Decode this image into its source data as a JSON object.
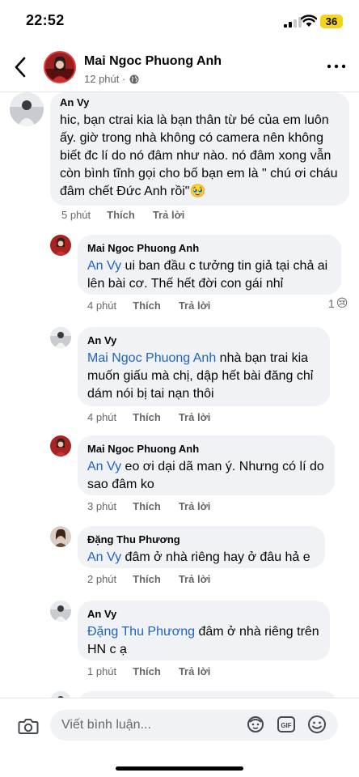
{
  "status_bar": {
    "time": "22:52",
    "battery": "36"
  },
  "header": {
    "name": "Mai Ngoc Phuong Anh",
    "subtitle": "12 phút ·"
  },
  "comments": [
    {
      "author": "An Vy",
      "mention": "",
      "text": "hic, bạn ctrai kia là bạn thân từ bé của em luôn ấy. giờ trong nhà không có camera nên không biết đc lí do nó đâm như nào. nó đâm xong vẫn còn bình tĩnh gọi cho bố bạn em là \" chú ơi cháu đâm chết Đức Anh rồi\"🥹",
      "time": "5 phút",
      "like": "Thích",
      "reply": "Trả lời"
    },
    {
      "author": "Mai Ngoc Phuong Anh",
      "mention": "An Vy",
      "text": " ui ban đầu c tưởng tin giả tại chả ai lên bài cơ. Thế hết đời con gái nhỉ",
      "time": "4 phút",
      "like": "Thích",
      "reply": "Trả lời",
      "reaction_count": "1",
      "reaction_emoji": "😢"
    },
    {
      "author": "An Vy",
      "mention": "Mai Ngoc Phuong Anh",
      "text": " nhà bạn trai kia muốn giấu mà chị, dập hết bài đăng chỉ dám nói bị tai nạn thôi",
      "time": "4 phút",
      "like": "Thích",
      "reply": "Trả lời"
    },
    {
      "author": "Mai Ngoc Phuong Anh",
      "mention": "An Vy",
      "text": " eo ơi dại dã man ý. Nhưng có lí do sao đâm ko",
      "time": "3 phút",
      "like": "Thích",
      "reply": "Trả lời"
    },
    {
      "author": "Đặng Thu Phương",
      "mention": "An Vy",
      "text": " đâm ở nhà riêng hay ở  đâu hả e",
      "time": "2 phút",
      "like": "Thích",
      "reply": "Trả lời"
    },
    {
      "author": "An Vy",
      "mention": "Đặng Thu Phương",
      "text": " đâm ở nhà riêng trên HN c ạ",
      "time": "1 phút",
      "like": "Thích",
      "reply": "Trả lời"
    }
  ],
  "composer": {
    "placeholder": "Viết bình luận..."
  },
  "colors": {
    "mention": "#1d64bf",
    "bubble": "#f0f2f5",
    "secondary_text": "#65676b"
  }
}
